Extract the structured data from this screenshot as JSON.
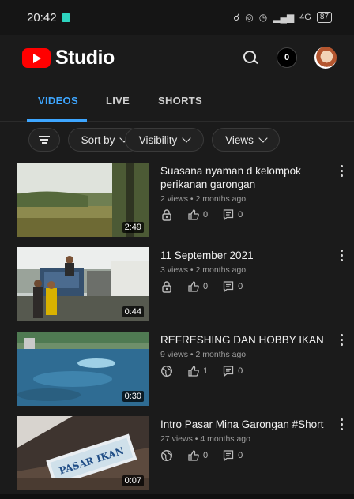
{
  "status_bar": {
    "time": "20:42",
    "network": "4G",
    "battery": "87"
  },
  "header": {
    "app_name": "Studio",
    "notification_count": "0"
  },
  "tabs": [
    {
      "label": "VIDEOS",
      "active": true
    },
    {
      "label": "LIVE",
      "active": false
    },
    {
      "label": "SHORTS",
      "active": false
    }
  ],
  "filters": {
    "sort_label": "Sort by",
    "visibility_label": "Visibility",
    "views_label": "Views"
  },
  "videos": [
    {
      "title": "Suasana nyaman d kelompok perikanan garongan",
      "meta": "2 views • 2 months ago",
      "duration": "2:49",
      "visibility_icon": "lock-icon",
      "likes": "0",
      "comments": "0"
    },
    {
      "title": "11 September 2021",
      "meta": "3 views • 2 months ago",
      "duration": "0:44",
      "visibility_icon": "lock-icon",
      "likes": "0",
      "comments": "0"
    },
    {
      "title": "REFRESHING DAN HOBBY IKAN",
      "meta": "9 views • 2 months ago",
      "duration": "0:30",
      "visibility_icon": "globe-icon",
      "likes": "1",
      "comments": "0"
    },
    {
      "title": "Intro Pasar Mina Garongan #Short",
      "meta": "27 views • 4 months ago",
      "duration": "0:07",
      "visibility_icon": "globe-icon",
      "likes": "0",
      "comments": "0",
      "thumbnail_sign": "PASAR IKAN"
    }
  ],
  "colors": {
    "background": "#1b1b1b",
    "accent": "#3ea6ff",
    "logo_red": "#ff0000"
  }
}
